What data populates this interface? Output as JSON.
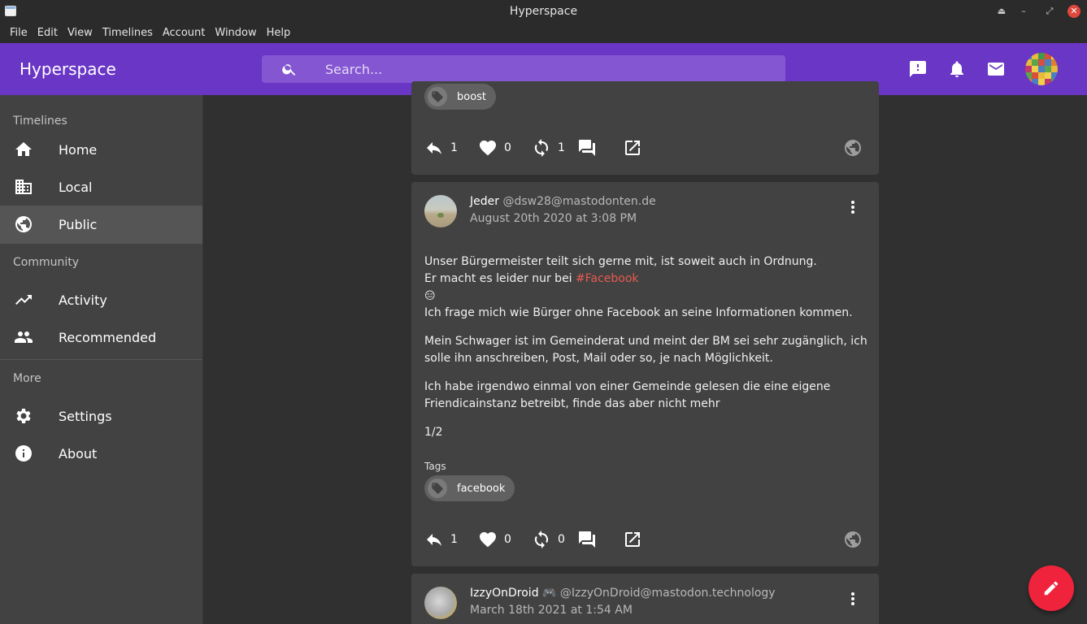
{
  "window": {
    "title": "Hyperspace"
  },
  "menubar": [
    "File",
    "Edit",
    "View",
    "Timelines",
    "Account",
    "Window",
    "Help"
  ],
  "appbar": {
    "brand": "Hyperspace",
    "search_placeholder": "Search..."
  },
  "sidebar": {
    "sections": [
      {
        "title": "Timelines",
        "items": [
          {
            "label": "Home",
            "icon": "home-icon",
            "active": false
          },
          {
            "label": "Local",
            "icon": "building-icon",
            "active": false
          },
          {
            "label": "Public",
            "icon": "globe-icon",
            "active": true
          }
        ]
      },
      {
        "title": "Community",
        "items": [
          {
            "label": "Activity",
            "icon": "trending-icon",
            "active": false
          },
          {
            "label": "Recommended",
            "icon": "people-icon",
            "active": false
          }
        ]
      },
      {
        "title": "More",
        "items": [
          {
            "label": "Settings",
            "icon": "gear-icon",
            "active": false
          },
          {
            "label": "About",
            "icon": "info-icon",
            "active": false
          }
        ]
      }
    ]
  },
  "posts": [
    {
      "tag_partial": "boost",
      "replies": "1",
      "favourites": "0",
      "boosts": "1"
    },
    {
      "author": "Jeder",
      "handle": "@dsw28@mastodonten.de",
      "date": "August 20th 2020 at 3:08 PM",
      "body_line1": "Unser Bürgermeister teilt sich gerne mit, ist soweit auch in Ordnung.",
      "body_line2_prefix": "Er macht es leider nur bei ",
      "body_hashtag": "#Facebook",
      "body_emoji": "😑",
      "body_line4": "Ich frage mich wie Bürger ohne Facebook an seine Informationen kommen.",
      "body_para2": "Mein Schwager ist im Gemeinderat und meint der BM sei sehr zugänglich, ich solle ihn anschreiben, Post, Mail oder so, je nach Möglichkeit.",
      "body_para3": "Ich habe irgendwo einmal von einer Gemeinde gelesen die eine eigene Friendicainstanz betreibt, finde das aber nicht mehr",
      "body_para4": "1/2",
      "tags_label": "Tags",
      "tags": [
        "facebook"
      ],
      "replies": "1",
      "favourites": "0",
      "boosts": "0"
    },
    {
      "author": "IzzyOnDroid 🎮",
      "handle": "@IzzyOnDroid@mastodon.technology",
      "date": "March 18th 2021 at 1:54 AM"
    }
  ],
  "colors": {
    "accent": "#6a36c6",
    "fab": "#f0233c",
    "hashtag": "#e85a4f"
  }
}
